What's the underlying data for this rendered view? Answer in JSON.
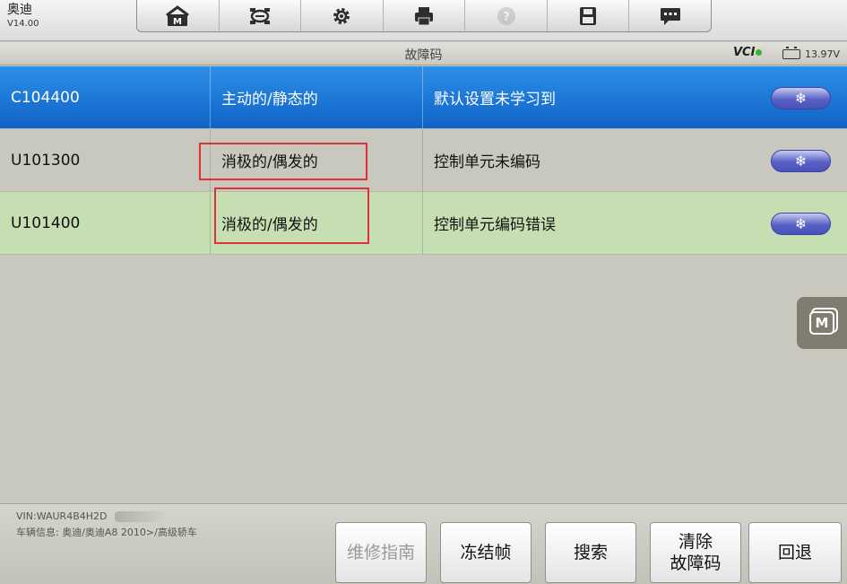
{
  "brand": {
    "name": "奥迪",
    "version": "V14.00"
  },
  "toolbar": {
    "icons": [
      "home-icon",
      "vehicle-icon",
      "settings-icon",
      "print-icon",
      "help-icon",
      "save-icon",
      "chat-icon"
    ]
  },
  "header": {
    "title": "故障码",
    "vci_label": "VCI",
    "voltage": "13.97V"
  },
  "dtc_rows": [
    {
      "code": "C104400",
      "status": "主动的/静态的",
      "description": "默认设置未学习到",
      "freeze_symbol": "❄"
    },
    {
      "code": "U101300",
      "status": "消极的/偶发的",
      "description": "控制单元未编码",
      "freeze_symbol": "❄"
    },
    {
      "code": "U101400",
      "status": "消极的/偶发的",
      "description": "控制单元编码错误",
      "freeze_symbol": "❄"
    }
  ],
  "colors": {
    "selected_row": "#1a74d6",
    "alt_row": "#c5dfb3",
    "highlight": "#e0303a",
    "freeze_button": "#5860c6"
  },
  "floating": {
    "label": "M"
  },
  "footer": {
    "vin": "VIN:WAUR4B4H2D",
    "vehicle_info": "车辆信息: 奥迪/奥迪A8 2010>/高级轿车",
    "buttons": {
      "repair_guide": "维修指南",
      "freeze_frame": "冻结帧",
      "search": "搜索",
      "clear_codes": "清除\n故障码",
      "back": "回退"
    }
  }
}
